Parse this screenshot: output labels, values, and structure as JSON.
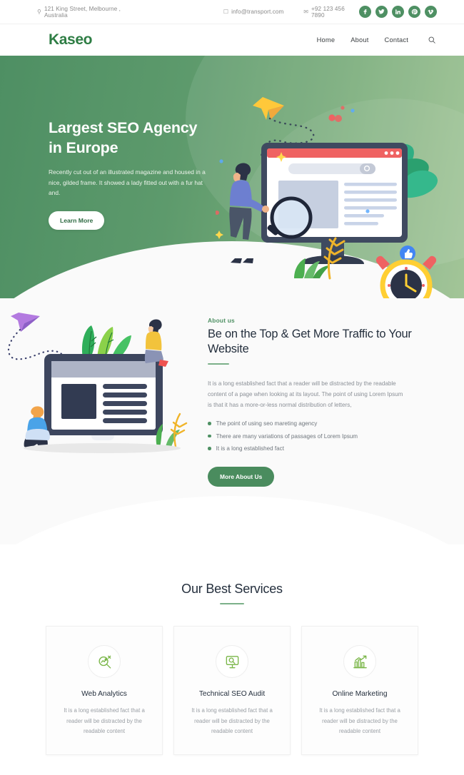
{
  "topbar": {
    "address": "121 King Street, Melbourne , Australia",
    "address_icon": "location-pin-icon",
    "email": "info@transport.com",
    "email_icon": "mobile-icon",
    "phone": "+92 123 456 7890",
    "phone_icon": "envelope-icon",
    "socials": [
      {
        "name": "facebook",
        "glyph": "f"
      },
      {
        "name": "twitter",
        "glyph": "t"
      },
      {
        "name": "linkedin",
        "glyph": "in"
      },
      {
        "name": "pinterest",
        "glyph": "p"
      },
      {
        "name": "vimeo",
        "glyph": "v"
      }
    ]
  },
  "header": {
    "logo": "Kaseo",
    "nav": [
      {
        "label": "Home"
      },
      {
        "label": "About"
      },
      {
        "label": "Contact"
      }
    ],
    "search_icon": "search-icon"
  },
  "hero": {
    "title": "Largest SEO Agency in Europe",
    "subtitle": "Recently cut out of an illustrated magazine and housed in a nice, gilded frame. It showed a lady fitted out with a fur hat and.",
    "cta": "Learn More"
  },
  "about": {
    "eyebrow": "About us",
    "title": "Be on the Top & Get More Traffic to Your Website",
    "body": "It is a long established fact that a reader will be distracted by the readable content of a page when looking at its layout. The point of using Lorem Ipsum is that it has a more-or-less normal distribution of letters,",
    "bullets": [
      "The point of using seo mareting agency",
      "There are many variations of passages of Lorem Ipsum",
      "It is a long established fact"
    ],
    "cta": "More About Us"
  },
  "services": {
    "title": "Our Best Services",
    "cards": [
      {
        "icon": "analytics-search-icon",
        "name": "Web Analytics",
        "desc": "It is a long established fact that a reader will be distracted by the readable content"
      },
      {
        "icon": "seo-audit-monitor-icon",
        "name": "Technical SEO Audit",
        "desc": "It is a long established fact that a reader will be distracted by the readable content"
      },
      {
        "icon": "bar-chart-growth-icon",
        "name": "Online Marketing",
        "desc": "It is a long established fact that a reader will be distracted by the readable content"
      }
    ]
  },
  "colors": {
    "brand_green": "#2e7d44",
    "accent_green": "#4e9063",
    "hero_gradient_start": "#4e8f63",
    "hero_gradient_end": "#9cc191",
    "heading_dark": "#242f3d",
    "muted_text": "#9a9fa5"
  }
}
